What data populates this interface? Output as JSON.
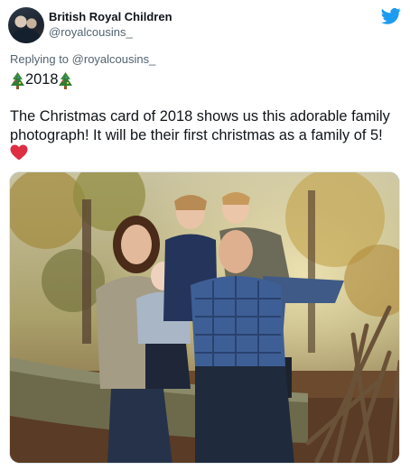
{
  "account": {
    "display_name": "British Royal Children",
    "handle": "@royalcousins_"
  },
  "reply": {
    "prefix": "Replying to",
    "to": "@royalcousins_"
  },
  "tweet": {
    "year_line": "2018",
    "line1": "The Christmas card of 2018 shows us this adorable family",
    "line2": "photograph! It will be their first christmas as a family of 5!"
  },
  "icons": {
    "brand": "twitter-bird-icon",
    "tree": "christmas-tree-emoji",
    "heart": "red-heart-emoji"
  },
  "colors": {
    "twitter_blue": "#1d9bf0",
    "heart_red": "#dd2e44",
    "secondary_text": "#536471"
  }
}
